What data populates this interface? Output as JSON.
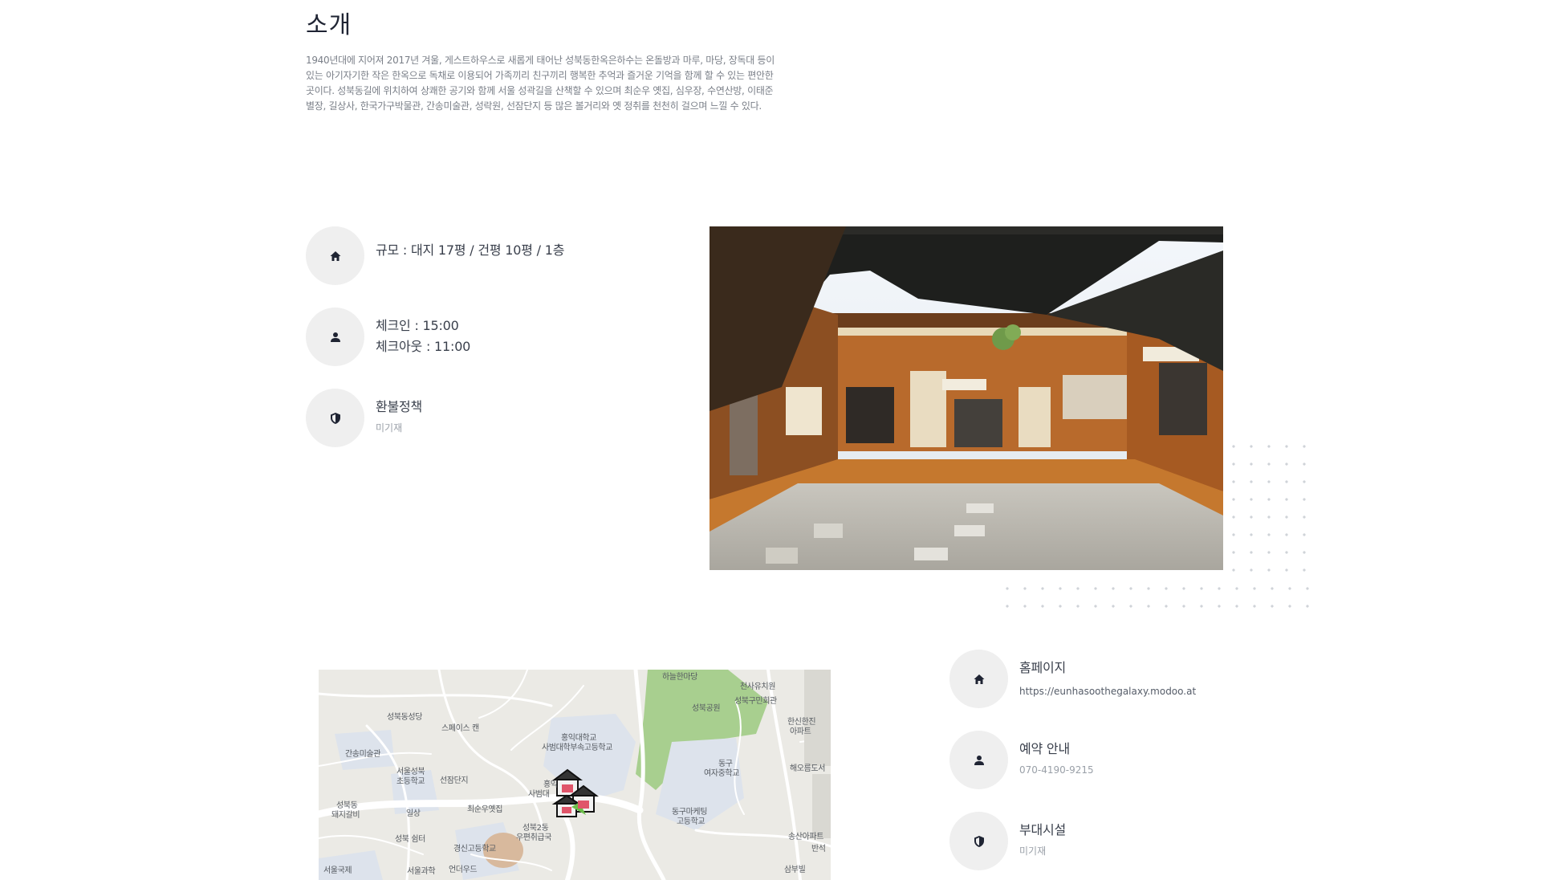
{
  "intro": {
    "title": "소개",
    "description": "1940년대에 지어져 2017년 겨울, 게스트하우스로 새롭게 태어난 성북동한옥은하수는 온돌방과 마루, 마당, 장독대 등이 있는 아기자기한 작은 한옥으로 독채로 이용되어 가족끼리 친구끼리 행복한 추억과 즐거운 기억을 함께 할 수 있는 편안한 곳이다. 성북동길에 위치하여 상쾌한 공기와 함께 서울 성곽길을 산책할 수 있으며 최순우 옛집, 심우장, 수연산방, 이태준 별장, 길상사, 한국가구박물관, 간송미술관, 성락원, 선잠단지 등 많은 볼거리와 옛 정취를 천천히 걸으며 느낄 수 있다."
  },
  "details": {
    "scale": {
      "icon": "home-icon",
      "text": "규모 : 대지 17평 / 건평 10평 / 1층"
    },
    "checktime": {
      "icon": "person-icon",
      "checkin": "체크인 : 15:00",
      "checkout": "체크아웃 : 11:00"
    },
    "refund": {
      "icon": "shield-icon",
      "title": "환불정책",
      "value": "미기재"
    }
  },
  "contact": {
    "homepage": {
      "icon": "home-icon",
      "title": "홈페이지",
      "url": "https://eunhasoothegalaxy.modoo.at"
    },
    "reservation": {
      "icon": "person-icon",
      "title": "예약 안내",
      "phone": "070-4190-9215"
    },
    "facilities": {
      "icon": "shield-icon",
      "title": "부대시설",
      "value": "미기재"
    }
  },
  "map": {
    "labels": [
      "하늘한마당",
      "천사유치원",
      "성북공원",
      "성북구민회관",
      "성북동성당",
      "스페이스 캔",
      "홍익대학교",
      "사범대학부속고등학교",
      "한신한진",
      "아파트",
      "간송미술관",
      "서울성북",
      "초등학교",
      "선잠단지",
      "홍익",
      "사범대",
      "동구",
      "여자중학교",
      "해오름도서",
      "성북동",
      "돼지갈비",
      "일상",
      "최순우옛집",
      "동구마케팅",
      "고등학교",
      "성북2동",
      "우편취급국",
      "성북 쉼터",
      "경신고등학교",
      "송산아파트",
      "반석",
      "서울국제",
      "서울과학",
      "언더우드",
      "삼부빌"
    ]
  },
  "colors": {
    "title": "#1f2433",
    "body_text": "#7a7f88",
    "circle_bg": "#efefef",
    "dot": "#cfd3d8"
  }
}
